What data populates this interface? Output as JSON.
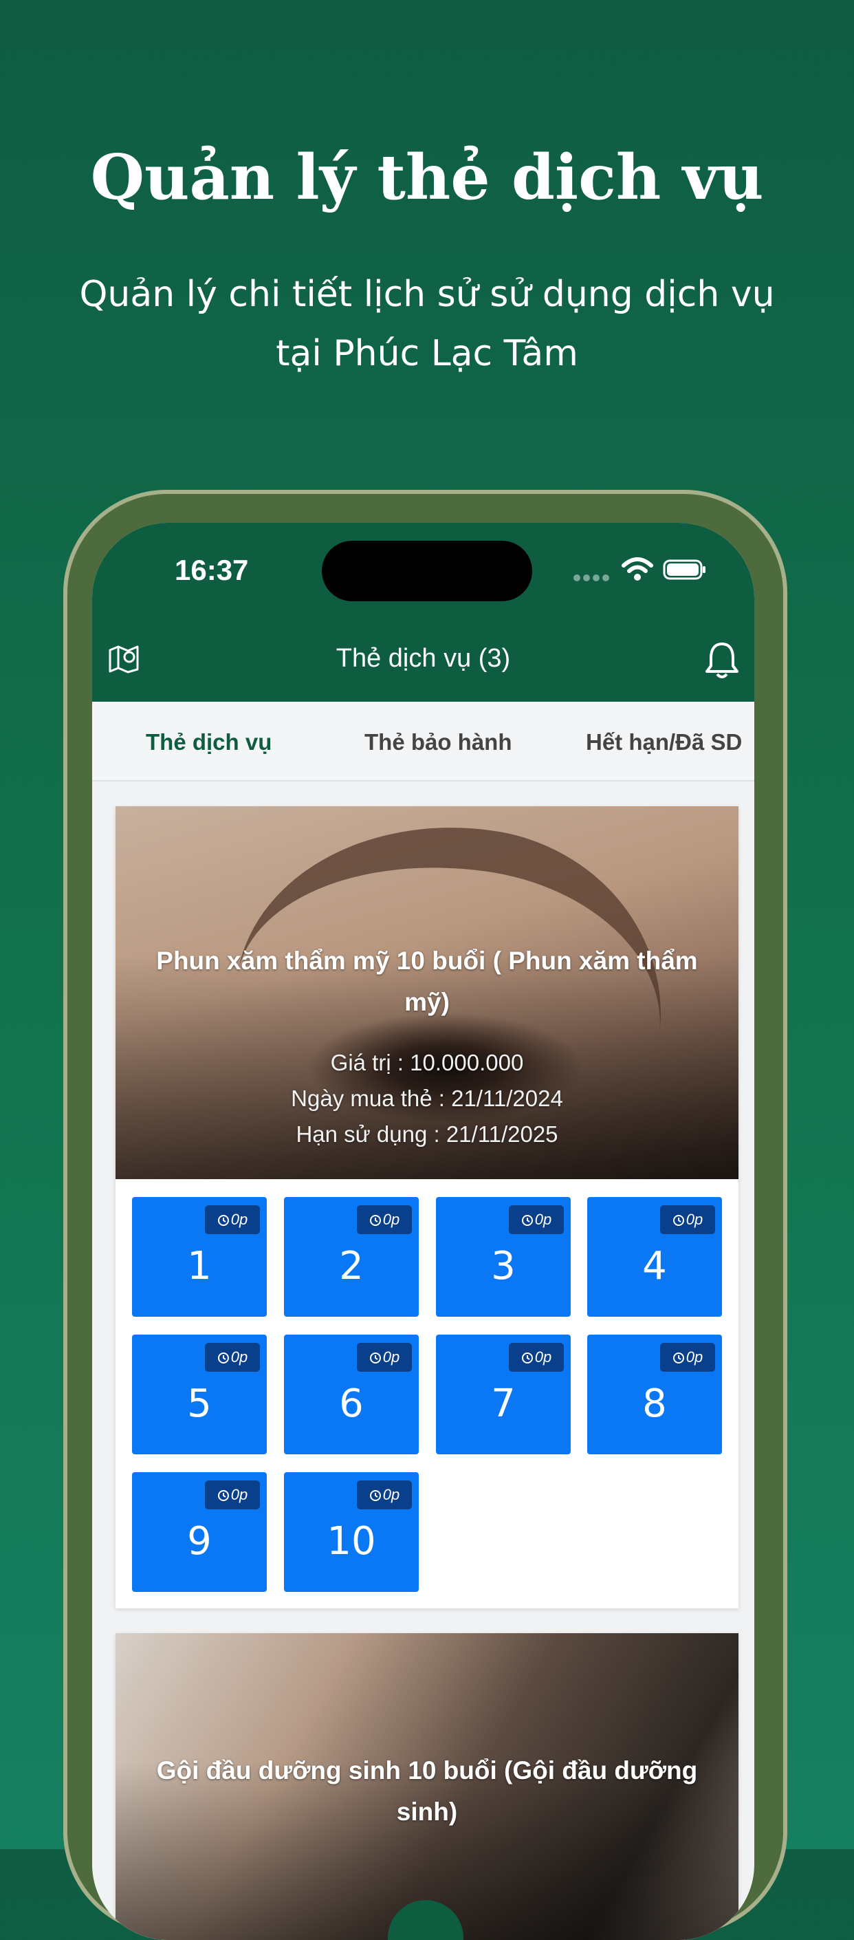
{
  "promo": {
    "headline": "Quản lý thẻ dịch vụ",
    "subtitle": "Quản lý chi tiết lịch sử sử dụng dịch vụ tại Phúc Lạc Tâm"
  },
  "status_bar": {
    "time": "16:37"
  },
  "header": {
    "title": "Thẻ dịch vụ (3)",
    "left_icon": "map-pin-icon",
    "right_icon": "bell-icon"
  },
  "tabs": [
    {
      "label": "Thẻ dịch vụ",
      "active": true
    },
    {
      "label": "Thẻ bảo hành",
      "active": false
    },
    {
      "label": "Hết hạn/Đã SD",
      "active": false
    }
  ],
  "cards": [
    {
      "title": "Phun xăm thẩm mỹ 10 buổi ( Phun xăm thẩm mỹ)",
      "value": "Giá trị : 10.000.000",
      "purchase_date": "Ngày mua thẻ : 21/11/2024",
      "expiry": "Hạn sử dụng : 21/11/2025",
      "sessions": [
        {
          "number": "1",
          "duration": "0p"
        },
        {
          "number": "2",
          "duration": "0p"
        },
        {
          "number": "3",
          "duration": "0p"
        },
        {
          "number": "4",
          "duration": "0p"
        },
        {
          "number": "5",
          "duration": "0p"
        },
        {
          "number": "6",
          "duration": "0p"
        },
        {
          "number": "7",
          "duration": "0p"
        },
        {
          "number": "8",
          "duration": "0p"
        },
        {
          "number": "9",
          "duration": "0p"
        },
        {
          "number": "10",
          "duration": "0p"
        }
      ]
    },
    {
      "title": "Gội đầu dưỡng sinh 10 buổi (Gội đầu dưỡng sinh)"
    }
  ],
  "colors": {
    "brand_green": "#0e5d41",
    "session_blue": "#0a77f5",
    "badge_navy": "#0a3f8c"
  }
}
